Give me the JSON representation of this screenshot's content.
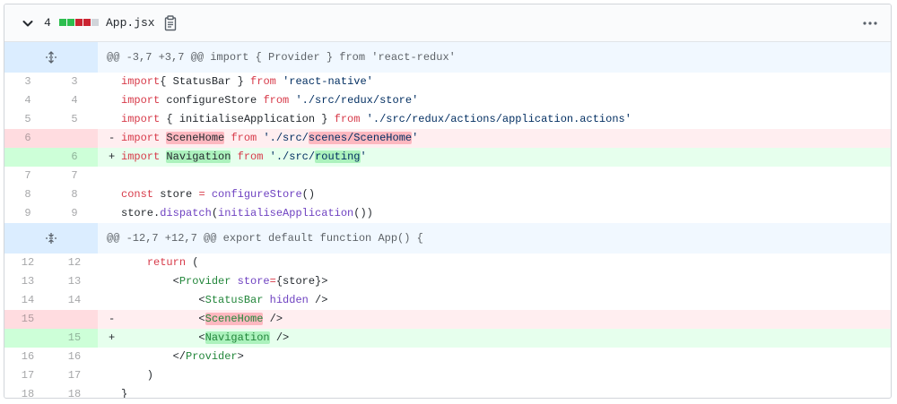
{
  "file": {
    "changes_count": "4",
    "diffstat_colors": [
      "#2cbe4e",
      "#2cbe4e",
      "#cb2431",
      "#cb2431",
      "#d1d5da"
    ],
    "filename": "App.jsx",
    "icons": {
      "collapse": "chevron-down-icon",
      "copy": "clipboard-icon",
      "menu": "kebab-horizontal-icon",
      "expand_up": "unfold-up-icon",
      "expand_both": "unfold-icon"
    }
  },
  "hunks": [
    {
      "header": "@@ -3,7 +3,7 @@ import { Provider } from 'react-redux'"
    },
    {
      "header": "@@ -12,7 +12,7 @@ export default function App() {"
    }
  ],
  "lines": [
    {
      "old": "3",
      "new": "3",
      "sign": "",
      "t": [
        [
          "kw",
          "import"
        ],
        [
          "",
          "{ StatusBar } "
        ],
        [
          "kw",
          "from"
        ],
        [
          "",
          " "
        ],
        [
          "str",
          "'react-native'"
        ]
      ]
    },
    {
      "old": "4",
      "new": "4",
      "sign": "",
      "t": [
        [
          "kw",
          "import"
        ],
        [
          "",
          " configureStore "
        ],
        [
          "kw",
          "from"
        ],
        [
          "",
          " "
        ],
        [
          "str",
          "'./src/redux/store'"
        ]
      ]
    },
    {
      "old": "5",
      "new": "5",
      "sign": "",
      "t": [
        [
          "kw",
          "import"
        ],
        [
          "",
          " { initialiseApplication } "
        ],
        [
          "kw",
          "from"
        ],
        [
          "",
          " "
        ],
        [
          "str",
          "'./src/redux/actions/application.actions'"
        ]
      ]
    },
    {
      "old": "6",
      "new": "",
      "sign": "-",
      "type": "del",
      "t": [
        [
          "kw",
          "import"
        ],
        [
          "",
          " "
        ],
        [
          "hl-del",
          "SceneHome"
        ],
        [
          "",
          " "
        ],
        [
          "kw",
          "from"
        ],
        [
          "",
          " "
        ],
        [
          "str",
          "'./src/"
        ],
        [
          "str hl-del",
          "scenes/SceneHome"
        ],
        [
          "str",
          "'"
        ]
      ]
    },
    {
      "old": "",
      "new": "6",
      "sign": "+",
      "type": "add",
      "t": [
        [
          "kw",
          "import"
        ],
        [
          "",
          " "
        ],
        [
          "hl-add",
          "Navigation"
        ],
        [
          "",
          " "
        ],
        [
          "kw",
          "from"
        ],
        [
          "",
          " "
        ],
        [
          "str",
          "'./src/"
        ],
        [
          "str hl-add",
          "routing"
        ],
        [
          "str",
          "'"
        ]
      ]
    },
    {
      "old": "7",
      "new": "7",
      "sign": "",
      "t": []
    },
    {
      "old": "8",
      "new": "8",
      "sign": "",
      "t": [
        [
          "kw",
          "const"
        ],
        [
          "",
          " store "
        ],
        [
          "kw",
          "="
        ],
        [
          "",
          " "
        ],
        [
          "fn",
          "configureStore"
        ],
        [
          "",
          "()"
        ]
      ]
    },
    {
      "old": "9",
      "new": "9",
      "sign": "",
      "t": [
        [
          "",
          "store."
        ],
        [
          "fn",
          "dispatch"
        ],
        [
          "",
          "("
        ],
        [
          "fn",
          "initialiseApplication"
        ],
        [
          "",
          "())"
        ]
      ]
    },
    {
      "old": "12",
      "new": "12",
      "sign": "",
      "t": [
        [
          "",
          "    "
        ],
        [
          "kw",
          "return"
        ],
        [
          "",
          " ("
        ]
      ]
    },
    {
      "old": "13",
      "new": "13",
      "sign": "",
      "t": [
        [
          "",
          "        <"
        ],
        [
          "tag",
          "Provider"
        ],
        [
          "",
          " "
        ],
        [
          "attr",
          "store"
        ],
        [
          "kw",
          "="
        ],
        [
          "",
          "{store}>"
        ]
      ]
    },
    {
      "old": "14",
      "new": "14",
      "sign": "",
      "t": [
        [
          "",
          "            <"
        ],
        [
          "tag",
          "StatusBar"
        ],
        [
          "",
          " "
        ],
        [
          "attr",
          "hidden"
        ],
        [
          "",
          " />"
        ]
      ]
    },
    {
      "old": "15",
      "new": "",
      "sign": "-",
      "type": "del",
      "t": [
        [
          "",
          "            <"
        ],
        [
          "tag hl-del",
          "SceneHome"
        ],
        [
          "",
          " />"
        ]
      ]
    },
    {
      "old": "",
      "new": "15",
      "sign": "+",
      "type": "add",
      "t": [
        [
          "",
          "            <"
        ],
        [
          "tag hl-add",
          "Navigation"
        ],
        [
          "",
          " />"
        ]
      ]
    },
    {
      "old": "16",
      "new": "16",
      "sign": "",
      "t": [
        [
          "",
          "        </"
        ],
        [
          "tag",
          "Provider"
        ],
        [
          "",
          ">"
        ]
      ]
    },
    {
      "old": "17",
      "new": "17",
      "sign": "",
      "t": [
        [
          "",
          "    )"
        ]
      ]
    },
    {
      "old": "18",
      "new": "18",
      "sign": "",
      "t": [
        [
          "",
          "}"
        ]
      ]
    }
  ]
}
